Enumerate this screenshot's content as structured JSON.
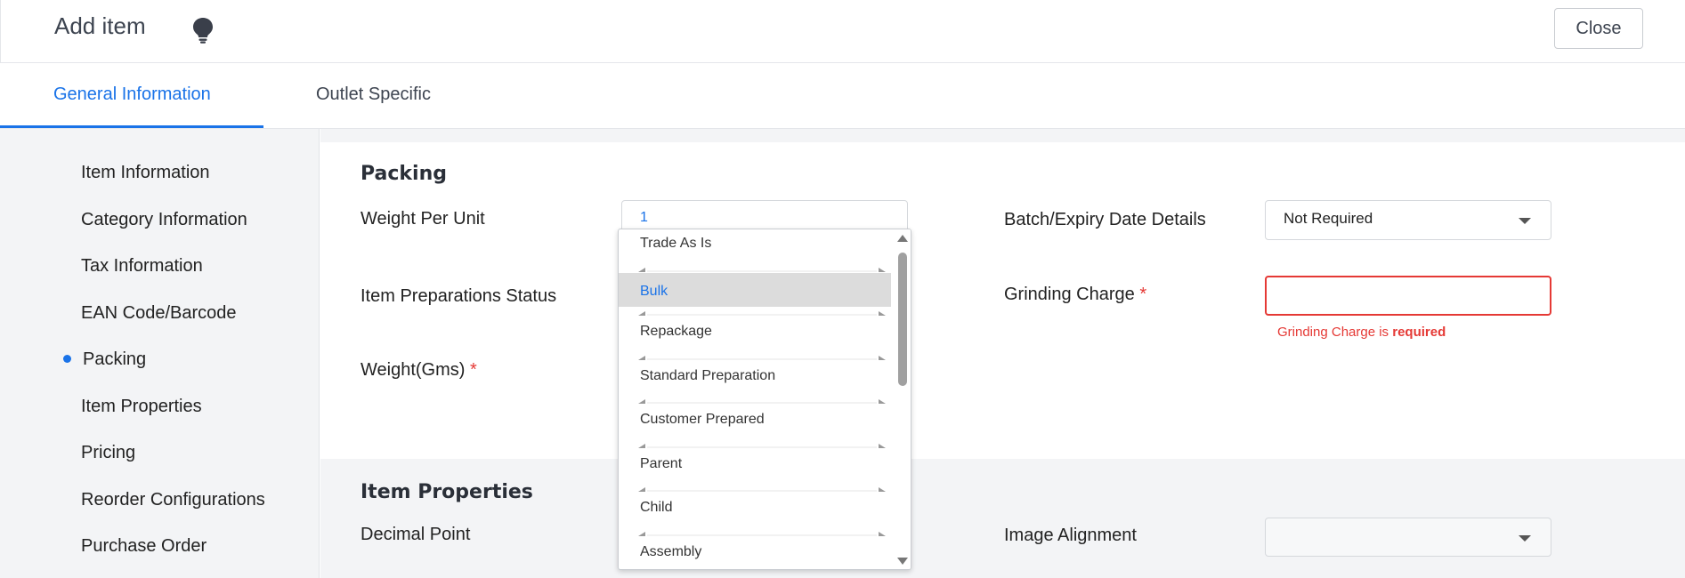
{
  "header": {
    "title": "Add item",
    "bulb_icon": "lightbulb-icon",
    "close_label": "Close"
  },
  "tabs": [
    {
      "label": "General Information",
      "active": true
    },
    {
      "label": "Outlet Specific",
      "active": false
    }
  ],
  "sidebar": {
    "items": [
      {
        "label": "Item Information"
      },
      {
        "label": "Category Information"
      },
      {
        "label": "Tax Information"
      },
      {
        "label": "EAN Code/Barcode"
      },
      {
        "label": "Packing",
        "active": true
      },
      {
        "label": "Item Properties"
      },
      {
        "label": "Pricing"
      },
      {
        "label": "Reorder Configurations"
      },
      {
        "label": "Purchase Order"
      }
    ]
  },
  "packing": {
    "title": "Packing",
    "weight_per_unit_label": "Weight Per Unit",
    "weight_per_unit_value": "1",
    "prep_status_label": "Item Preparations Status",
    "weight_gms_label": "Weight(Gms)",
    "required_mark": "*",
    "batch_label": "Batch/Expiry Date Details",
    "batch_value": "Not Required",
    "grinding_label": "Grinding Charge",
    "grinding_value": "",
    "grinding_error_prefix": "Grinding Charge is ",
    "grinding_error_strong": "required"
  },
  "item_properties": {
    "title": "Item Properties",
    "decimal_label": "Decimal Point",
    "image_alignment_label": "Image Alignment",
    "image_alignment_value": ""
  },
  "prep_dropdown": {
    "options": [
      "Trade As Is",
      "Bulk",
      "Repackage",
      "Standard Preparation",
      "Customer Prepared",
      "Parent",
      "Child",
      "Assembly"
    ],
    "selected": "Bulk"
  },
  "colors": {
    "accent": "#1a73e8",
    "error": "#e53935",
    "sidebar_bg": "#f3f4f6"
  }
}
